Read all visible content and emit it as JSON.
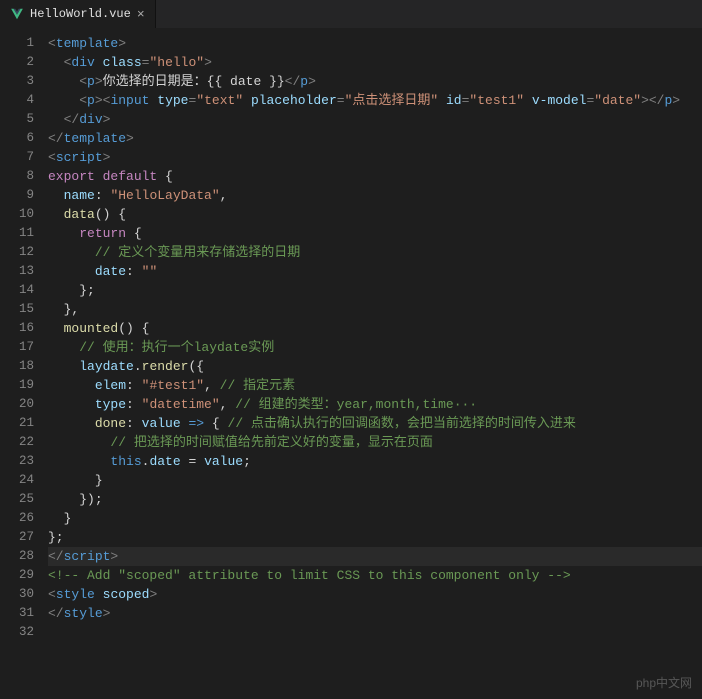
{
  "tab": {
    "filename": "HelloWorld.vue",
    "icon": "vue-icon"
  },
  "watermark": "php中文网",
  "highlight_line": 28,
  "code": {
    "lines": [
      {
        "n": 1,
        "tokens": [
          {
            "c": "t-punct",
            "t": "<"
          },
          {
            "c": "t-tag",
            "t": "template"
          },
          {
            "c": "t-punct",
            "t": ">"
          }
        ]
      },
      {
        "n": 2,
        "tokens": [
          {
            "c": "",
            "t": "  "
          },
          {
            "c": "t-punct",
            "t": "<"
          },
          {
            "c": "t-tag",
            "t": "div"
          },
          {
            "c": "",
            "t": " "
          },
          {
            "c": "t-attr",
            "t": "class"
          },
          {
            "c": "t-punct",
            "t": "="
          },
          {
            "c": "t-str",
            "t": "\"hello\""
          },
          {
            "c": "t-punct",
            "t": ">"
          }
        ]
      },
      {
        "n": 3,
        "tokens": [
          {
            "c": "",
            "t": "    "
          },
          {
            "c": "t-punct",
            "t": "<"
          },
          {
            "c": "t-tag",
            "t": "p"
          },
          {
            "c": "t-punct",
            "t": ">"
          },
          {
            "c": "t-text",
            "t": "你选择的日期是：{{ date }}"
          },
          {
            "c": "t-punct",
            "t": "</"
          },
          {
            "c": "t-tag",
            "t": "p"
          },
          {
            "c": "t-punct",
            "t": ">"
          }
        ]
      },
      {
        "n": 4,
        "tokens": [
          {
            "c": "",
            "t": "    "
          },
          {
            "c": "t-punct",
            "t": "<"
          },
          {
            "c": "t-tag",
            "t": "p"
          },
          {
            "c": "t-punct",
            "t": "><"
          },
          {
            "c": "t-tag",
            "t": "input"
          },
          {
            "c": "",
            "t": " "
          },
          {
            "c": "t-attr",
            "t": "type"
          },
          {
            "c": "t-punct",
            "t": "="
          },
          {
            "c": "t-str",
            "t": "\"text\""
          },
          {
            "c": "",
            "t": " "
          },
          {
            "c": "t-attr",
            "t": "placeholder"
          },
          {
            "c": "t-punct",
            "t": "="
          },
          {
            "c": "t-str",
            "t": "\"点击选择日期\""
          },
          {
            "c": "",
            "t": " "
          },
          {
            "c": "t-attr",
            "t": "id"
          },
          {
            "c": "t-punct",
            "t": "="
          },
          {
            "c": "t-str",
            "t": "\"test1\""
          },
          {
            "c": "",
            "t": " "
          },
          {
            "c": "t-attr",
            "t": "v-model"
          },
          {
            "c": "t-punct",
            "t": "="
          },
          {
            "c": "t-str",
            "t": "\"date\""
          },
          {
            "c": "t-punct",
            "t": "></"
          },
          {
            "c": "t-tag",
            "t": "p"
          },
          {
            "c": "t-punct",
            "t": ">"
          }
        ]
      },
      {
        "n": 5,
        "tokens": [
          {
            "c": "",
            "t": "  "
          },
          {
            "c": "t-punct",
            "t": "</"
          },
          {
            "c": "t-tag",
            "t": "div"
          },
          {
            "c": "t-punct",
            "t": ">"
          }
        ]
      },
      {
        "n": 6,
        "tokens": [
          {
            "c": "t-punct",
            "t": "</"
          },
          {
            "c": "t-tag",
            "t": "template"
          },
          {
            "c": "t-punct",
            "t": ">"
          }
        ]
      },
      {
        "n": 7,
        "tokens": [
          {
            "c": "t-punct",
            "t": "<"
          },
          {
            "c": "t-tag",
            "t": "script"
          },
          {
            "c": "t-punct",
            "t": ">"
          }
        ]
      },
      {
        "n": 8,
        "tokens": [
          {
            "c": "t-kw",
            "t": "export"
          },
          {
            "c": "",
            "t": " "
          },
          {
            "c": "t-kw",
            "t": "default"
          },
          {
            "c": "",
            "t": " "
          },
          {
            "c": "t-brace",
            "t": "{"
          }
        ]
      },
      {
        "n": 9,
        "tokens": [
          {
            "c": "",
            "t": "  "
          },
          {
            "c": "t-var",
            "t": "name"
          },
          {
            "c": "t-text",
            "t": ": "
          },
          {
            "c": "t-str",
            "t": "\"HelloLayData\""
          },
          {
            "c": "t-text",
            "t": ","
          }
        ]
      },
      {
        "n": 10,
        "tokens": [
          {
            "c": "",
            "t": "  "
          },
          {
            "c": "t-fn",
            "t": "data"
          },
          {
            "c": "t-brace",
            "t": "()"
          },
          {
            "c": "",
            "t": " "
          },
          {
            "c": "t-brace",
            "t": "{"
          }
        ]
      },
      {
        "n": 11,
        "tokens": [
          {
            "c": "",
            "t": "    "
          },
          {
            "c": "t-kw",
            "t": "return"
          },
          {
            "c": "",
            "t": " "
          },
          {
            "c": "t-brace",
            "t": "{"
          }
        ]
      },
      {
        "n": 12,
        "tokens": [
          {
            "c": "",
            "t": "      "
          },
          {
            "c": "t-cmt",
            "t": "// 定义个变量用来存储选择的日期"
          }
        ]
      },
      {
        "n": 13,
        "tokens": [
          {
            "c": "",
            "t": "      "
          },
          {
            "c": "t-var",
            "t": "date"
          },
          {
            "c": "t-text",
            "t": ": "
          },
          {
            "c": "t-str",
            "t": "\"\""
          }
        ]
      },
      {
        "n": 14,
        "tokens": [
          {
            "c": "",
            "t": "    "
          },
          {
            "c": "t-brace",
            "t": "};"
          }
        ]
      },
      {
        "n": 15,
        "tokens": [
          {
            "c": "",
            "t": "  "
          },
          {
            "c": "t-brace",
            "t": "},"
          }
        ]
      },
      {
        "n": 16,
        "tokens": [
          {
            "c": "",
            "t": "  "
          },
          {
            "c": "t-fn",
            "t": "mounted"
          },
          {
            "c": "t-brace",
            "t": "()"
          },
          {
            "c": "",
            "t": " "
          },
          {
            "c": "t-brace",
            "t": "{"
          }
        ]
      },
      {
        "n": 17,
        "tokens": [
          {
            "c": "",
            "t": "    "
          },
          {
            "c": "t-cmt",
            "t": "// 使用：执行一个laydate实例"
          }
        ]
      },
      {
        "n": 18,
        "tokens": [
          {
            "c": "",
            "t": "    "
          },
          {
            "c": "t-var",
            "t": "laydate"
          },
          {
            "c": "t-text",
            "t": "."
          },
          {
            "c": "t-fn",
            "t": "render"
          },
          {
            "c": "t-brace",
            "t": "({"
          }
        ]
      },
      {
        "n": 19,
        "tokens": [
          {
            "c": "",
            "t": "      "
          },
          {
            "c": "t-var",
            "t": "elem"
          },
          {
            "c": "t-text",
            "t": ": "
          },
          {
            "c": "t-str",
            "t": "\"#test1\""
          },
          {
            "c": "t-text",
            "t": ", "
          },
          {
            "c": "t-cmt",
            "t": "// 指定元素"
          }
        ]
      },
      {
        "n": 20,
        "tokens": [
          {
            "c": "",
            "t": "      "
          },
          {
            "c": "t-var",
            "t": "type"
          },
          {
            "c": "t-text",
            "t": ": "
          },
          {
            "c": "t-str",
            "t": "\"datetime\""
          },
          {
            "c": "t-text",
            "t": ", "
          },
          {
            "c": "t-cmt",
            "t": "// 组建的类型：year,month,time···"
          }
        ]
      },
      {
        "n": 21,
        "tokens": [
          {
            "c": "",
            "t": "      "
          },
          {
            "c": "t-fn",
            "t": "done"
          },
          {
            "c": "t-text",
            "t": ": "
          },
          {
            "c": "t-var",
            "t": "value"
          },
          {
            "c": "",
            "t": " "
          },
          {
            "c": "t-arrow",
            "t": "=>"
          },
          {
            "c": "",
            "t": " "
          },
          {
            "c": "t-brace",
            "t": "{"
          },
          {
            "c": "",
            "t": " "
          },
          {
            "c": "t-cmt",
            "t": "// 点击确认执行的回调函数，会把当前选择的时间传入进来"
          }
        ]
      },
      {
        "n": 22,
        "tokens": [
          {
            "c": "",
            "t": "        "
          },
          {
            "c": "t-cmt",
            "t": "// 把选择的时间赋值给先前定义好的变量，显示在页面"
          }
        ]
      },
      {
        "n": 23,
        "tokens": [
          {
            "c": "",
            "t": "        "
          },
          {
            "c": "t-kw2",
            "t": "this"
          },
          {
            "c": "t-text",
            "t": "."
          },
          {
            "c": "t-var",
            "t": "date"
          },
          {
            "c": "t-text",
            "t": " = "
          },
          {
            "c": "t-var",
            "t": "value"
          },
          {
            "c": "t-text",
            "t": ";"
          }
        ]
      },
      {
        "n": 24,
        "tokens": [
          {
            "c": "",
            "t": "      "
          },
          {
            "c": "t-brace",
            "t": "}"
          }
        ]
      },
      {
        "n": 25,
        "tokens": [
          {
            "c": "",
            "t": "    "
          },
          {
            "c": "t-brace",
            "t": "});"
          }
        ]
      },
      {
        "n": 26,
        "tokens": [
          {
            "c": "",
            "t": "  "
          },
          {
            "c": "t-brace",
            "t": "}"
          }
        ]
      },
      {
        "n": 27,
        "tokens": [
          {
            "c": "t-brace",
            "t": "};"
          }
        ]
      },
      {
        "n": 28,
        "tokens": [
          {
            "c": "t-punct",
            "t": "</"
          },
          {
            "c": "t-tag",
            "t": "script"
          },
          {
            "c": "t-punct",
            "t": ">"
          }
        ]
      },
      {
        "n": 29,
        "tokens": [
          {
            "c": "t-cmt",
            "t": "<!-- Add \"scoped\" attribute to limit CSS to this component only -->"
          }
        ]
      },
      {
        "n": 30,
        "tokens": [
          {
            "c": "t-punct",
            "t": "<"
          },
          {
            "c": "t-tag",
            "t": "style"
          },
          {
            "c": "",
            "t": " "
          },
          {
            "c": "t-attr",
            "t": "scoped"
          },
          {
            "c": "t-punct",
            "t": ">"
          }
        ]
      },
      {
        "n": 31,
        "tokens": [
          {
            "c": "t-punct",
            "t": "</"
          },
          {
            "c": "t-tag",
            "t": "style"
          },
          {
            "c": "t-punct",
            "t": ">"
          }
        ]
      },
      {
        "n": 32,
        "tokens": []
      }
    ]
  }
}
